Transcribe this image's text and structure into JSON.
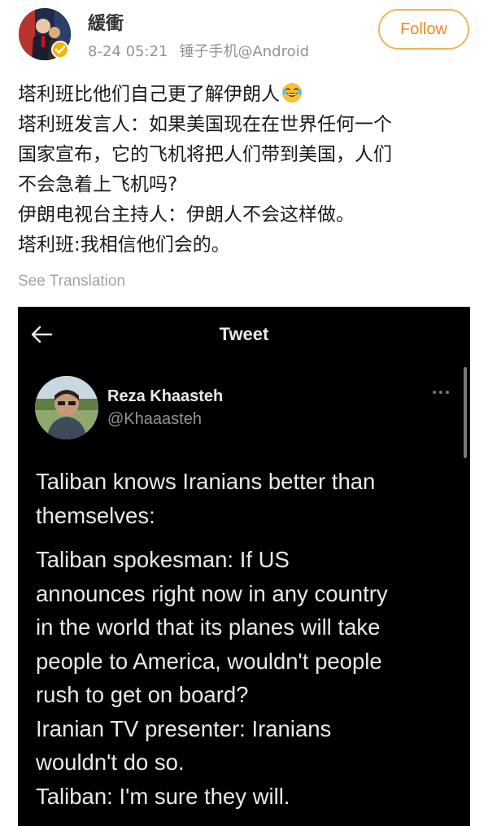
{
  "post": {
    "username": "緩衝",
    "timestamp": "8-24 05:21",
    "source": "锤子手机@Android",
    "follow_label": "Follow",
    "text_lines": [
      "塔利班比他们自己更了解伊朗人",
      "塔利班发言人：如果美国现在在世界任何一个",
      "国家宣布，它的飞机将把人们带到美国，人们",
      "不会急着上飞机吗?",
      "伊朗电视台主持人：伊朗人不会这样做。",
      "塔利班:我相信他们会的。"
    ],
    "emoji": "laughing-tears-emoji",
    "see_translation": "See Translation"
  },
  "tweet": {
    "header_title": "Tweet",
    "author_name": "Reza Khaasteh",
    "author_handle": "@Khaaasteh",
    "body_lines_1": [
      "Taliban knows Iranians better than",
      "themselves:"
    ],
    "body_lines_2": [
      "Taliban spokesman: If US",
      "announces right now in any country",
      "in the world that its planes will take",
      "people to America, wouldn't people",
      "rush to get on board?",
      "Iranian TV presenter: Iranians",
      "wouldn't do so.",
      "Taliban: I'm sure they will."
    ]
  },
  "colors": {
    "follow_accent": "#f08a1c",
    "verified_badge": "#f5b20a",
    "tweet_background": "#000000"
  }
}
